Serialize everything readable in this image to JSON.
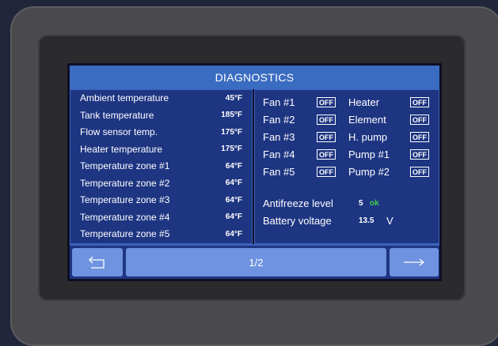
{
  "title": "DIAGNOSTICS",
  "sensors": [
    {
      "label": "Ambient temperature",
      "value": "45°F"
    },
    {
      "label": "Tank temperature",
      "value": "185°F"
    },
    {
      "label": "Flow sensor temp.",
      "value": "175°F"
    },
    {
      "label": "Heater temperature",
      "value": "175°F"
    },
    {
      "label": "Temperature zone #1",
      "value": "64°F"
    },
    {
      "label": "Temperature zone #2",
      "value": "64°F"
    },
    {
      "label": "Temperature zone #3",
      "value": "64°F"
    },
    {
      "label": "Temperature zone #4",
      "value": "64°F"
    },
    {
      "label": "Temperature zone #5",
      "value": "64°F"
    }
  ],
  "devices_left": [
    {
      "label": "Fan  #1",
      "state": "OFF"
    },
    {
      "label": "Fan  #2",
      "state": "OFF"
    },
    {
      "label": "Fan  #3",
      "state": "OFF"
    },
    {
      "label": "Fan  #4",
      "state": "OFF"
    },
    {
      "label": "Fan  #5",
      "state": "OFF"
    }
  ],
  "devices_right": [
    {
      "label": "Heater",
      "state": "OFF"
    },
    {
      "label": "Element",
      "state": "OFF"
    },
    {
      "label": "H. pump",
      "state": "OFF"
    },
    {
      "label": "Pump #1",
      "state": "OFF"
    },
    {
      "label": "Pump #2",
      "state": "OFF"
    }
  ],
  "antifreeze": {
    "label": "Antifreeze level",
    "value": "5",
    "status": "ok"
  },
  "battery": {
    "label": "Battery voltage",
    "value": "13.5",
    "unit": "V"
  },
  "nav": {
    "back_icon": "return-arrow-icon",
    "page": "1/2",
    "next_icon": "right-arrow-icon"
  },
  "colors": {
    "title_bar": "#3a6cc1",
    "panel": "#1e3582",
    "button": "#6f93e0",
    "ok": "#3fd04a"
  }
}
